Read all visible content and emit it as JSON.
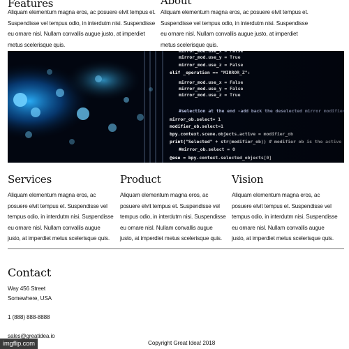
{
  "features": {
    "title": "Features",
    "text": "Aliquam elementum magna eros, ac posuere elvit tempus et. Suspendisse vel tempus odio, in interdutm nisi. Suspendisse eu ornare nisl. Nullam convallis augue justo, at imperdiet metus scelerisque quis."
  },
  "about": {
    "title": "About",
    "text": "Aliquam elementum magna eros, ac posuere elvit tempus et. Suspendisse vel tempus odio, in interdutm nisi. Suspendisse eu ornare nisl. Nullam convallis augue justo, at imperdiet metus scelerisque quis."
  },
  "hero": {
    "code_lines": [
      "mirror_mod.use_x = False",
      "mirror_mod.use_y = True",
      "mirror_mod.use_z = False",
      "elif _operation == \"MIRROR_Z\":",
      "mirror_mod.use_x = False",
      "mirror_mod.use_y = False",
      "mirror_mod.use_z = True",
      "#selection at the end -add back the deselected mirror modifier object",
      "mirror_ob.select= 1",
      "modifier_ob.select=1",
      "bpy.context.scene.objects.active = modifier_ob",
      "print(\"Selected\" + str(modifier_ob)) # modifier ob is the active ob",
      "#mirror_ob.select = 0",
      "@ese = bpy.context.selected_objects[0]"
    ],
    "colors": {
      "background": "#020610",
      "glow": "#1a9cff"
    }
  },
  "services": {
    "title": "Services",
    "text": "Aliquam elementum magna eros, ac posuere elvit tempus et. Suspendisse vel tempus odio, in interdutm nisi. Suspendisse eu ornare nisl. Nullam convallis augue justo, at imperdiet metus scelerisque quis."
  },
  "product": {
    "title": "Product",
    "text": "Aliquam elementum magna eros, ac posuere elvit tempus et. Suspendisse vel tempus odio, in interdutm nisi. Suspendisse eu ornare nisl. Nullam convallis augue justo, at imperdiet metus scelerisque quis."
  },
  "vision": {
    "title": "Vision",
    "text": "Aliquam elementum magna eros, ac posuere elvit tempus et. Suspendisse vel tempus odio, in interdutm nisi. Suspendisse eu ornare nisl. Nullam convallis augue justo, at imperdiet metus scelerisque quis."
  },
  "contact": {
    "title": "Contact",
    "street": "Way 456 Street",
    "city": "Somewhere, USA",
    "phone": "1 (888) 888-8888",
    "email": "sales@greatidea.io"
  },
  "footer": {
    "copyright": "Copyright Great Idea! 2018"
  },
  "watermark": {
    "text": "imgflip.com"
  }
}
